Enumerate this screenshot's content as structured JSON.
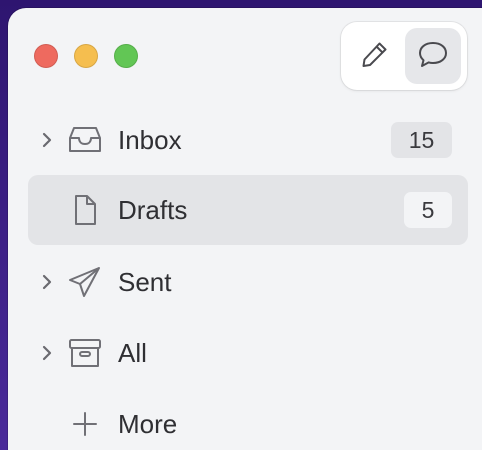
{
  "toolbar": {
    "compose_icon": "pencil-icon",
    "chat_icon": "speech-bubble-icon"
  },
  "window_controls": [
    "close",
    "minimize",
    "maximize"
  ],
  "mailboxes": [
    {
      "label": "Inbox",
      "count": "15",
      "icon": "inbox-tray-icon",
      "expandable": true,
      "selected": false
    },
    {
      "label": "Drafts",
      "count": "5",
      "icon": "document-icon",
      "expandable": false,
      "selected": true
    },
    {
      "label": "Sent",
      "count": "",
      "icon": "paper-plane-icon",
      "expandable": true,
      "selected": false
    },
    {
      "label": "All",
      "count": "",
      "icon": "archive-box-icon",
      "expandable": true,
      "selected": false
    }
  ],
  "more": {
    "label": "More",
    "icon": "plus-icon"
  },
  "colors": {
    "close": "#ee6a5f",
    "minimize": "#f5be4f",
    "maximize": "#62c655",
    "sidebar_bg": "#f3f4f6",
    "selected_bg": "#e3e4e7"
  }
}
